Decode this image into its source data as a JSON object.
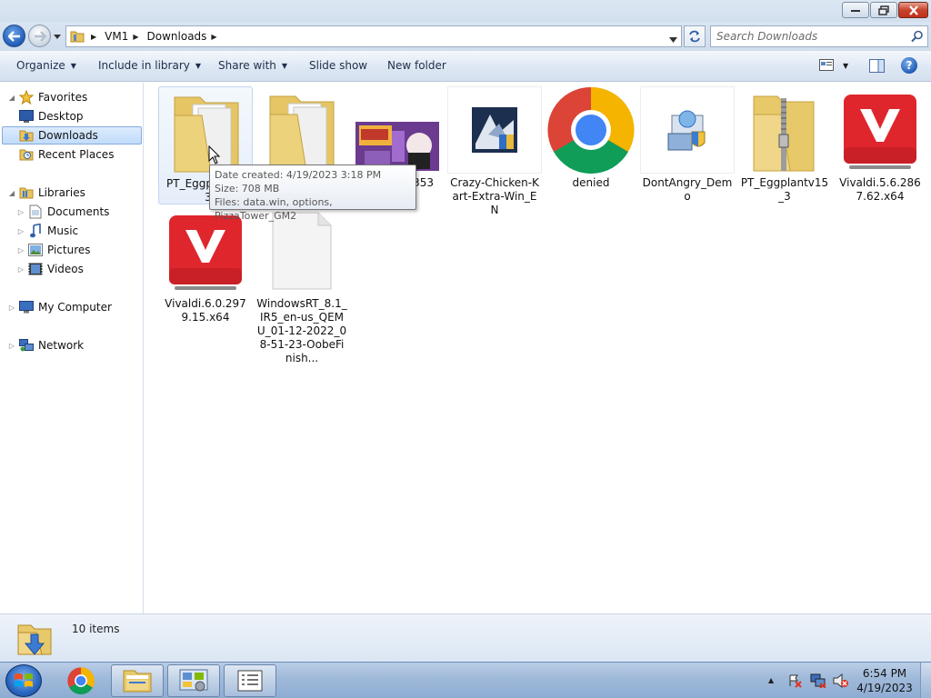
{
  "window": {
    "controls": {
      "minimize": "minimize",
      "maximize": "restore",
      "close": "close"
    }
  },
  "navigation": {
    "breadcrumb": [
      "VM1",
      "Downloads"
    ],
    "search_placeholder": "Search Downloads"
  },
  "commandbar": {
    "organize": "Organize",
    "include": "Include in library",
    "share": "Share with",
    "slideshow": "Slide show",
    "newfolder": "New folder"
  },
  "navpane": {
    "favorites": {
      "label": "Favorites",
      "items": [
        "Desktop",
        "Downloads",
        "Recent Places"
      ],
      "selected": "Downloads"
    },
    "libraries": {
      "label": "Libraries",
      "items": [
        "Documents",
        "Music",
        "Pictures",
        "Videos"
      ]
    },
    "computer": "My Computer",
    "network": "Network"
  },
  "files": [
    {
      "name": "PT_Eggpl",
      "name_line2": "3",
      "icon": "folder-icon",
      "hovered": true
    },
    {
      "name": "",
      "icon": "folder-icon"
    },
    {
      "name": "x353",
      "icon": "image-thumbnail-icon"
    },
    {
      "name": "Crazy-Chicken-Kart-Extra-Win_EN",
      "icon": "installer-icon"
    },
    {
      "name": "denied",
      "icon": "chrome-icon"
    },
    {
      "name": "DontAngry_Demo",
      "icon": "setup-icon"
    },
    {
      "name": "PT_Eggplantv15_3",
      "icon": "zip-folder-icon"
    },
    {
      "name": "Vivaldi.5.6.2867.62.x64",
      "icon": "vivaldi-icon"
    },
    {
      "name": "Vivaldi.6.0.2979.15.x64",
      "icon": "vivaldi-icon"
    },
    {
      "name": "WindowsRT_8.1_IR5_en-us_QEMU_01-12-2022_08-51-23-OobeFinish...",
      "icon": "blank-file-icon"
    }
  ],
  "tooltip": {
    "date": "Date created: 4/19/2023 3:18 PM",
    "size": "Size: 708 MB",
    "files": "Files: data.win, options, PizzaTower_GM2"
  },
  "details": {
    "count": "10 items"
  },
  "taskbar": {
    "apps": [
      "chrome-icon",
      "explorer-icon",
      "control-panel-icon",
      "notepad-icon"
    ],
    "time": "6:54 PM",
    "date": "4/19/2023"
  },
  "colors": {
    "accent": "#1f5cb6",
    "selection": "#c1dcfb",
    "vivaldi": "#e0262d"
  }
}
